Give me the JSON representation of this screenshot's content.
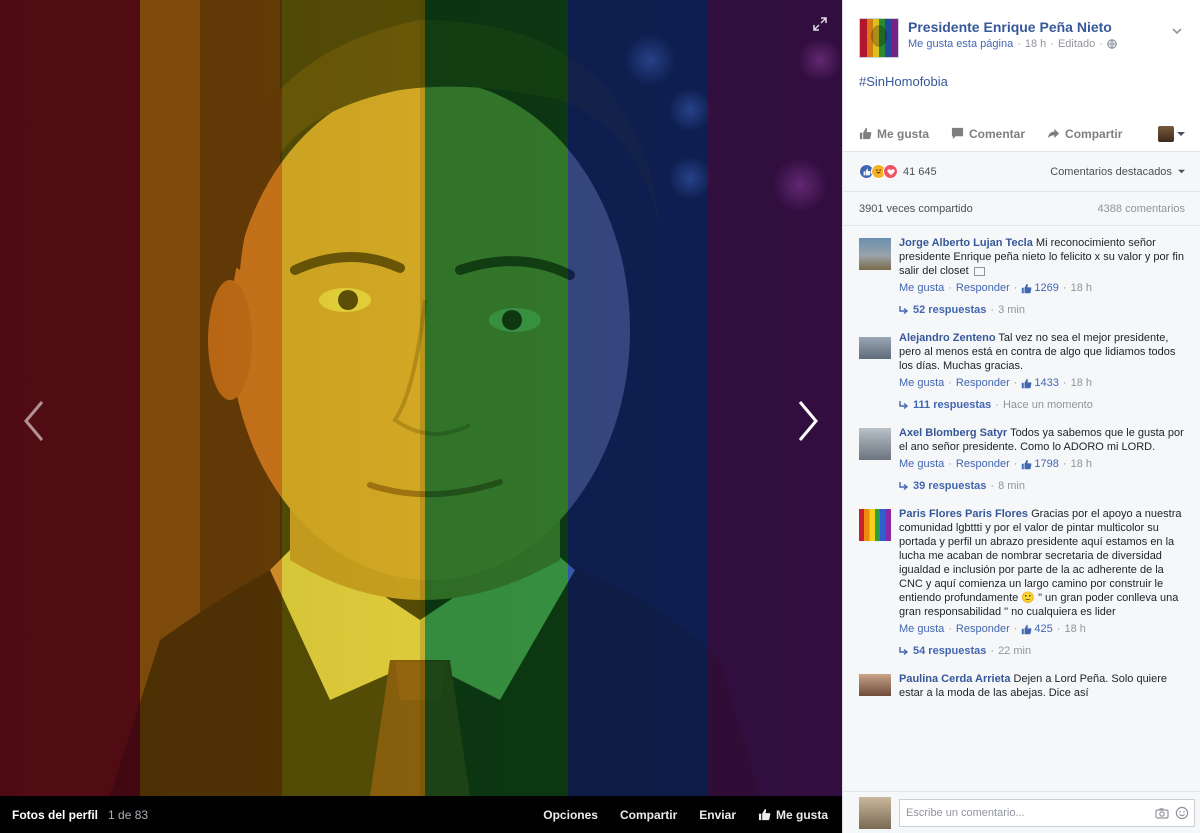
{
  "photo_bar": {
    "album": "Fotos del perfil",
    "counter": "1 de 83",
    "options": "Opciones",
    "share": "Compartir",
    "send": "Enviar",
    "like": "Me gusta"
  },
  "post": {
    "page_name": "Presidente Enrique Peña Nieto",
    "like_page": "Me gusta esta página",
    "time": "18 h",
    "edited": "Editado",
    "caption": "#SinHomofobia"
  },
  "actions": {
    "like": "Me gusta",
    "comment": "Comentar",
    "share": "Compartir"
  },
  "stats": {
    "reactions": "41 645",
    "featured": "Comentarios destacados",
    "shares": "3901 veces compartido",
    "comments": "4388 comentarios"
  },
  "comments": [
    {
      "author": "Jorge Alberto Lujan Tecla",
      "text": "Mi reconocimiento señor presidente Enrique peña nieto lo felicito x su valor y por fin salir del closet",
      "like": "Me gusta",
      "reply": "Responder",
      "likes": "1269",
      "time": "18 h",
      "replies": "52 respuestas",
      "replies_time": "3 min"
    },
    {
      "author": "Alejandro Zenteno",
      "text": "Tal vez no sea el mejor presidente, pero al menos está en contra de algo que lidiamos todos los días. Muchas gracias.",
      "like": "Me gusta",
      "reply": "Responder",
      "likes": "1433",
      "time": "18 h",
      "replies": "111 respuestas",
      "replies_time": "Hace un momento"
    },
    {
      "author": "Axel Blomberg Satyr",
      "text": "Todos ya sabemos que le gusta por el ano señor presidente. Como lo ADORO mi LORD.",
      "like": "Me gusta",
      "reply": "Responder",
      "likes": "1798",
      "time": "18 h",
      "replies": "39 respuestas",
      "replies_time": "8 min"
    },
    {
      "author": "Paris Flores Paris Flores",
      "text": "Gracias por el apoyo a nuestra comunidad lgbttti y por el valor de pintar multicolor su portada y perfil un abrazo presidente aquí estamos en la lucha me acaban de nombrar secretaria de diversidad igualdad e inclusión por parte de la ac adherente de la CNC y aquí comienza un largo camino por construir le entiendo profundamente 🙂 \" un gran poder conlleva una gran responsabilidad \" no cualquiera es lider",
      "like": "Me gusta",
      "reply": "Responder",
      "likes": "425",
      "time": "18 h",
      "replies": "54 respuestas",
      "replies_time": "22 min"
    },
    {
      "author": "Paulina Cerda Arrieta",
      "text": "Dejen a Lord Peña. Solo quiere estar a la moda de las abejas. Dice así",
      "like": "",
      "reply": "",
      "likes": "",
      "time": "",
      "replies": "",
      "replies_time": ""
    }
  ],
  "composer": {
    "placeholder": "Escribe un comentario..."
  },
  "colors": {
    "link": "#365899",
    "rainbow": [
      "#b4001e",
      "#e06a00",
      "#e8c000",
      "#1f8f2a",
      "#1846a8",
      "#7a1f8a"
    ]
  }
}
